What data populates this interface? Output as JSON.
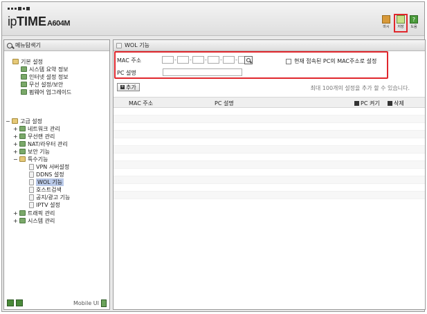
{
  "header": {
    "brand_prefix": "ip",
    "brand_strong": "TIME",
    "model": "A604M",
    "buttons": [
      {
        "label": "마시",
        "icon": "restart-icon",
        "color": "#d89a3a"
      },
      {
        "label": "저장",
        "icon": "save-icon",
        "color": "#9cc35a"
      },
      {
        "label": "도움",
        "icon": "help-icon",
        "color": "#4a9a3a"
      }
    ],
    "help_glyph": "?"
  },
  "sidebar": {
    "title": "메뉴탐색기",
    "basic_group": "기본 설정",
    "basic_items": [
      "시스템 요약 정보",
      "인터넷 설정 정보",
      "무선 설정/보안",
      "펌웨어 업그레이드"
    ],
    "advanced_group": "고급 설정",
    "advanced_items": [
      "네트워크 관리",
      "무선랜 관리",
      "NAT/라우터 관리",
      "보안 기능",
      "특수기능"
    ],
    "special_items": [
      "VPN 서버설정",
      "DDNS 설정",
      "WOL 기능",
      "호스트검색",
      "공지/광고 기능",
      "IPTV 설정"
    ],
    "more_items": [
      "트래픽 관리",
      "시스템 관리"
    ],
    "mobile_label": "Mobile UI",
    "expand_glyph": "+",
    "collapse_glyph": "−"
  },
  "main": {
    "title": "WOL 기능",
    "mac_label": "MAC 주소",
    "mac_dash": "-",
    "pc_label": "PC 설명",
    "checkbox_label": "현재 접속된 PC의 MAC주소로 설정",
    "add_label": "추가",
    "add_glyph": "+",
    "hint": "최대 100개의 설정을 추가 할 수 있습니다.",
    "columns": {
      "mac": "MAC 주소",
      "pc": "PC 설명",
      "wake": "PC 켜기",
      "delete": "삭제"
    }
  },
  "colors": {
    "highlight": "#e0262c",
    "selected": "#b9c9e8"
  }
}
